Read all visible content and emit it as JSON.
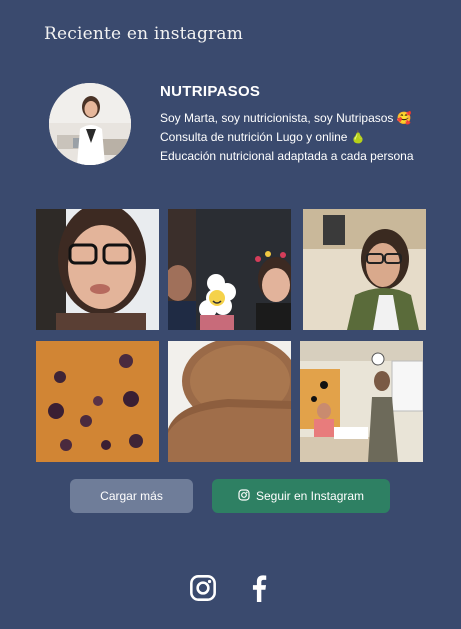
{
  "section": {
    "title": "Reciente en instagram"
  },
  "profile": {
    "name": "NUTRIPASOS",
    "bio": [
      "Soy Marta, soy nutricionista, soy Nutripasos 🥰",
      "Consulta de nutrición Lugo y online 🍐",
      "Educación nutricional adaptada a cada persona"
    ]
  },
  "buttons": {
    "load_more": "Cargar más",
    "follow": "Seguir en Instagram"
  },
  "icons": {
    "follow": "instagram-icon",
    "social": [
      "instagram-icon",
      "facebook-icon"
    ]
  },
  "colors": {
    "background": "#3a4a6e",
    "load_more_button": "#6f7d99",
    "follow_button": "#2e8063",
    "text": "#ffffff"
  }
}
